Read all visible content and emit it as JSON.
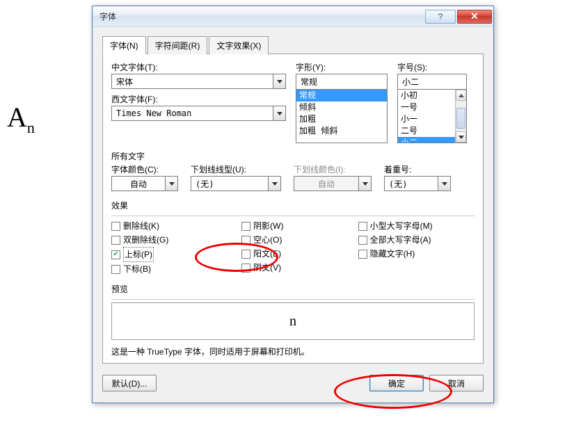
{
  "bg_text_main": "A",
  "bg_text_sub": "n",
  "title": "字体",
  "tabs": [
    {
      "label": "字体(N)",
      "active": true
    },
    {
      "label": "字符间距(R)",
      "active": false
    },
    {
      "label": "文字效果(X)",
      "active": false
    }
  ],
  "labels": {
    "cn_font": "中文字体(T):",
    "en_font": "西文字体(F):",
    "style": "字形(Y):",
    "size": "字号(S):",
    "all_text": "所有文字",
    "font_color": "字体颜色(C):",
    "underline_style": "下划线线型(U):",
    "underline_color": "下划线颜色(I):",
    "emphasis": "着重号:",
    "effects": "效果",
    "preview": "预览",
    "note": "这是一种 TrueType 字体，同时适用于屏幕和打印机。"
  },
  "values": {
    "cn_font": "宋体",
    "en_font": "Times New Roman",
    "style_sel": "常规",
    "size_sel": "小二",
    "font_color": "自动",
    "underline_style": "(无)",
    "underline_color": "自动",
    "emphasis": "(无)",
    "preview": "n"
  },
  "style_list": [
    "常规",
    "倾斜",
    "加粗",
    "加粗 倾斜"
  ],
  "size_list": [
    "小初",
    "一号",
    "小一",
    "二号",
    "小二"
  ],
  "effects_col1": [
    {
      "label": "删除线(K)",
      "checked": false
    },
    {
      "label": "双删除线(G)",
      "checked": false
    },
    {
      "label": "上标(P)",
      "checked": true
    },
    {
      "label": "下标(B)",
      "checked": false
    }
  ],
  "effects_col2": [
    {
      "label": "阴影(W)",
      "checked": false
    },
    {
      "label": "空心(O)",
      "checked": false
    },
    {
      "label": "阳文(E)",
      "checked": false
    },
    {
      "label": "阴文(V)",
      "checked": false
    }
  ],
  "effects_col3": [
    {
      "label": "小型大写字母(M)",
      "checked": false
    },
    {
      "label": "全部大写字母(A)",
      "checked": false
    },
    {
      "label": "隐藏文字(H)",
      "checked": false
    }
  ],
  "buttons": {
    "default": "默认(D)...",
    "ok": "确定",
    "cancel": "取消"
  }
}
